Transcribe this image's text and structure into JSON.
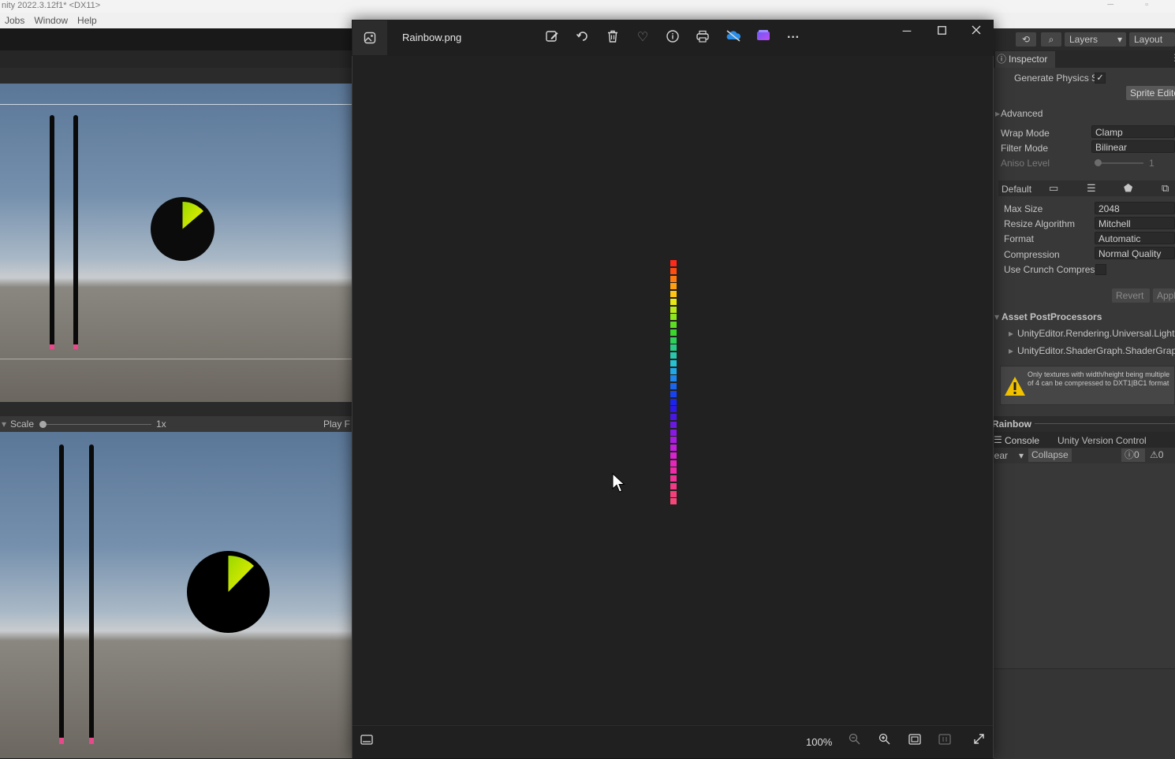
{
  "unity": {
    "title": "nity 2022.3.12f1* <DX11>",
    "menu": [
      "Jobs",
      "Window",
      "Help"
    ],
    "scale_label": "Scale",
    "scale_value": "1x",
    "play_label": "Play F"
  },
  "photos": {
    "filename": "Rainbow.png",
    "toolbar_icons": [
      "edit-image-icon",
      "rotate-icon",
      "delete-icon",
      "favorite-icon",
      "info-icon",
      "print-icon",
      "onedrive-icon",
      "clipchamp-icon",
      "more-icon"
    ],
    "zoom": "100%",
    "rainbow_colors": [
      "#ff2a1a",
      "#ff4d12",
      "#ff7a10",
      "#ffa010",
      "#ffc512",
      "#e8e816",
      "#b8e81a",
      "#8ee61e",
      "#5ede22",
      "#3ad62c",
      "#2ed05a",
      "#2acb86",
      "#28c8ad",
      "#26c2d2",
      "#22a8e6",
      "#1e86ea",
      "#1a64ee",
      "#1842f0",
      "#1a24ec",
      "#2c18e8",
      "#4a18e6",
      "#6a18e4",
      "#8a1ae2",
      "#a81ce0",
      "#c21edc",
      "#da22d0",
      "#e826bc",
      "#ee2ca8",
      "#f03296",
      "#f23a86",
      "#f4407a",
      "#f4487a"
    ]
  },
  "inspector": {
    "tab": "Inspector",
    "layers": "Layers",
    "layout": "Layout",
    "generate_physics": "Generate Physics S",
    "sprite_editor": "Sprite Edito",
    "advanced": "Advanced",
    "wrap_mode_label": "Wrap Mode",
    "wrap_mode_value": "Clamp",
    "filter_mode_label": "Filter Mode",
    "filter_mode_value": "Bilinear",
    "aniso_label": "Aniso Level",
    "aniso_value": "1",
    "platform_default": "Default",
    "max_size_label": "Max Size",
    "max_size_value": "2048",
    "resize_label": "Resize Algorithm",
    "resize_value": "Mitchell",
    "format_label": "Format",
    "format_value": "Automatic",
    "compression_label": "Compression",
    "compression_value": "Normal Quality",
    "crunch_label": "Use Crunch Compres",
    "revert": "Revert",
    "apply": "Appl",
    "postprocessors_header": "Asset PostProcessors",
    "pp1": "UnityEditor.Rendering.Universal.Light",
    "pp2": "UnityEditor.ShaderGraph.ShaderGrap",
    "warning": "Only textures with width/height being multiple of 4 can be compressed to DXT1|BC1 format",
    "asset_name": "Rainbow",
    "console_tab": "Console",
    "version_control_tab": "Unity Version Control",
    "clear": "lear",
    "collapse": "Collapse",
    "count_info": "0",
    "count_warn": "0"
  }
}
